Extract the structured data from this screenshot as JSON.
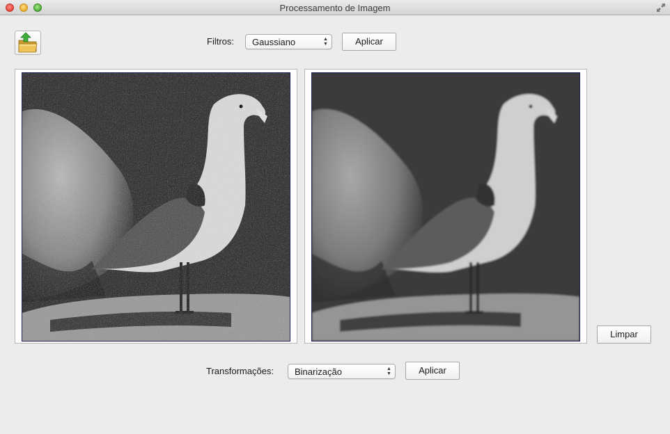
{
  "window": {
    "title": "Processamento de Imagem"
  },
  "toolbar": {
    "open_icon": "open-folder-icon",
    "filters_label": "Filtros:",
    "filter_selected": "Gaussiano",
    "filter_apply_label": "Aplicar"
  },
  "images": {
    "original": {
      "description_icon": "seagull-noisy-image"
    },
    "processed": {
      "description_icon": "seagull-filtered-image"
    }
  },
  "actions": {
    "clear_label": "Limpar"
  },
  "transforms": {
    "label": "Transformações:",
    "selected": "Binarização",
    "apply_label": "Aplicar"
  },
  "colors": {
    "window_bg": "#ececec",
    "image_border": "#1c2458"
  }
}
